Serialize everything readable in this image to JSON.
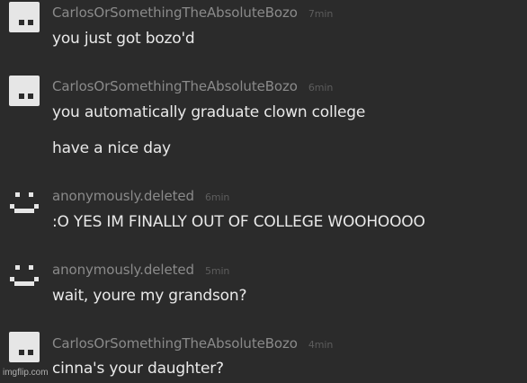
{
  "messages": [
    {
      "username": "CarlosOrSomethingTheAbsoluteBozo",
      "time": "7min",
      "avatar": "block-avatar",
      "lines": [
        "you just got bozo'd"
      ]
    },
    {
      "username": "CarlosOrSomethingTheAbsoluteBozo",
      "time": "6min",
      "avatar": "block-avatar",
      "lines": [
        "you automatically graduate clown college",
        "have a nice day"
      ]
    },
    {
      "username": "anonymously.deleted",
      "time": "6min",
      "avatar": "smiley-avatar",
      "lines": [
        ":O YES IM FINALLY OUT OF COLLEGE WOOHOOOO"
      ]
    },
    {
      "username": "anonymously.deleted",
      "time": "5min",
      "avatar": "smiley-avatar",
      "lines": [
        "wait, youre my grandson?"
      ]
    },
    {
      "username": "CarlosOrSomethingTheAbsoluteBozo",
      "time": "4min",
      "avatar": "block-avatar",
      "lines": [
        "cinna's your daughter?"
      ]
    }
  ],
  "watermark": "imgflip.com",
  "colors": {
    "background": "#2b2b2b",
    "username": "#8a8a8a",
    "timestamp": "#5d5d5d",
    "text": "#e9e9e9",
    "avatar": "#e6e6e6"
  }
}
